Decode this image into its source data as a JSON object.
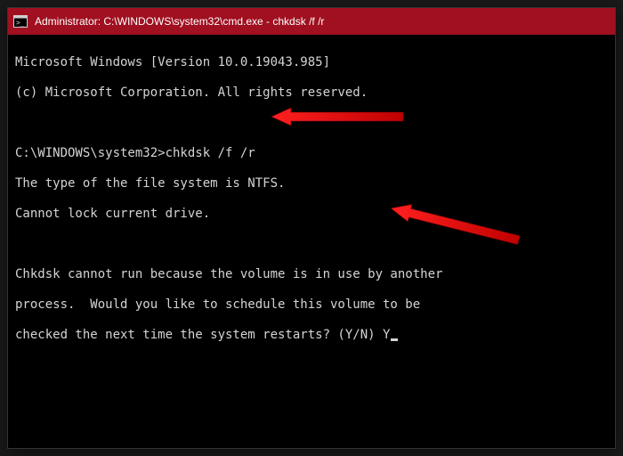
{
  "titlebar": {
    "title": "Administrator: C:\\WINDOWS\\system32\\cmd.exe - chkdsk  /f /r"
  },
  "content": {
    "banner_line1": "Microsoft Windows [Version 10.0.19043.985]",
    "banner_line2": "(c) Microsoft Corporation. All rights reserved.",
    "prompt": "C:\\WINDOWS\\system32>",
    "command": "chkdsk /f /r",
    "out_line1": "The type of the file system is NTFS.",
    "out_line2": "Cannot lock current drive.",
    "out_line3": "Chkdsk cannot run because the volume is in use by another",
    "out_line4": "process.  Would you like to schedule this volume to be",
    "out_line5_prompt": "checked the next time the system restarts? (Y/N) ",
    "user_input": "Y"
  },
  "annotations": {
    "arrow1": "arrow-pointing-to-command",
    "arrow2": "arrow-pointing-to-input"
  }
}
